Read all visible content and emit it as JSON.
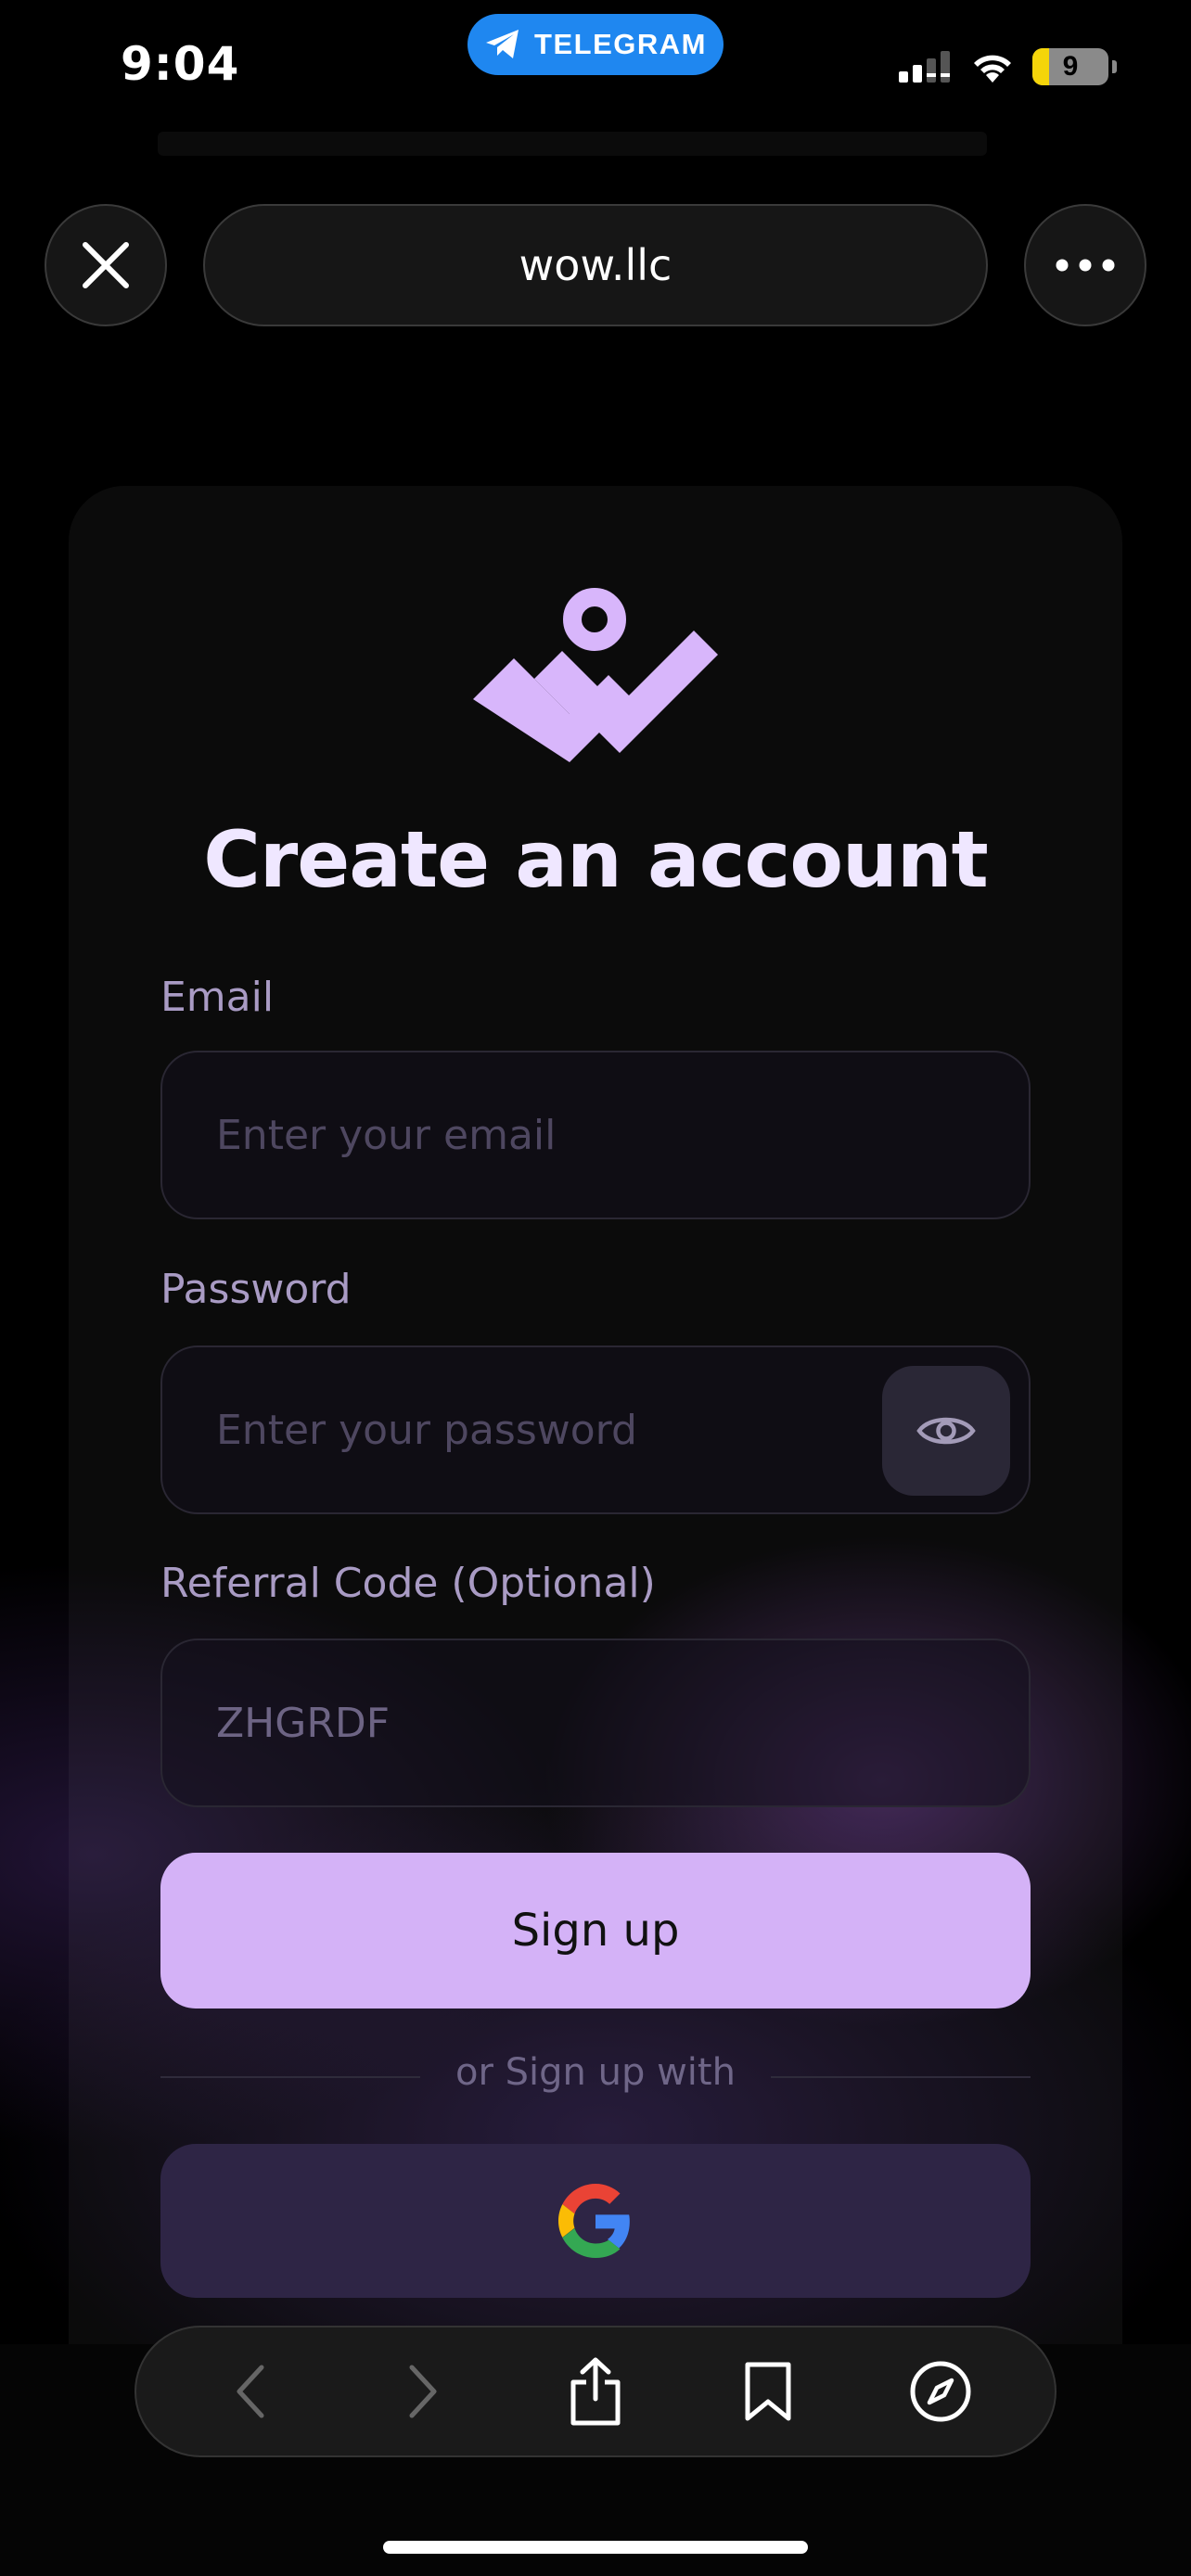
{
  "status_bar": {
    "time": "9:04",
    "app_pill": "TELEGRAM",
    "battery": "9"
  },
  "browser": {
    "url": "wow.llc",
    "close_icon": "close-icon",
    "more_icon": "more-icon"
  },
  "form": {
    "title": "Create an account",
    "email_label": "Email",
    "email_placeholder": "Enter your email",
    "password_label": "Password",
    "password_placeholder": "Enter your password",
    "referral_label": "Referral Code (Optional)",
    "referral_value": "ZHGRDF",
    "signup_label": "Sign up",
    "or_text": "or Sign up with"
  },
  "toolbar": {
    "icons": [
      "back-icon",
      "forward-icon",
      "share-icon",
      "bookmark-icon",
      "compass-icon"
    ]
  },
  "colors": {
    "accent": "#d4b2f7",
    "logo": "#d8b6fb",
    "telegram": "#1f87f0"
  }
}
